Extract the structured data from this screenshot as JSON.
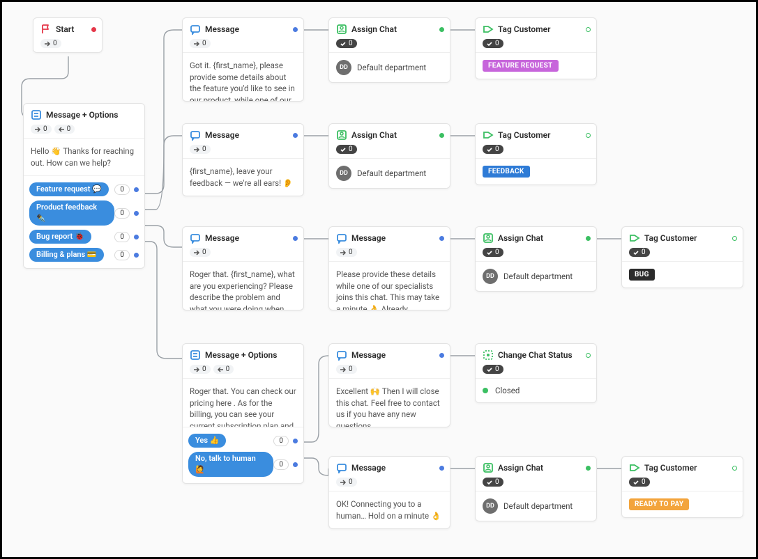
{
  "start": {
    "title": "Start",
    "count": 0
  },
  "mo1": {
    "title": "Message + Options",
    "count_out": 0,
    "count_in": 0,
    "body": "Hello 👋 Thanks for reaching out. How can we help?",
    "options": [
      {
        "label": "Feature request 💬",
        "count": 0
      },
      {
        "label": "Product feedback ✒️",
        "count": 0
      },
      {
        "label": "Bug report 🐞",
        "count": 0
      },
      {
        "label": "Billing & plans 💳",
        "count": 0
      }
    ]
  },
  "msg1": {
    "title": "Message",
    "count": 0,
    "body": "Got it. {first_name}, please provide some details about the feature you'd like to see in our product, while one of our experts joins this chat."
  },
  "msg2": {
    "title": "Message",
    "count": 0,
    "body": "{first_name}, leave your feedback — we're all ears! 👂"
  },
  "msg3": {
    "title": "Message",
    "count": 0,
    "body": "Roger that. {first_name}, what are you experiencing? Please describe the problem and what you were doing when you encountered it. If"
  },
  "msg3b": {
    "title": "Message",
    "count": 0,
    "body": "Please provide these details while one of our specialists joins this chat. This may take a minute 👌 Already"
  },
  "mo2": {
    "title": "Message + Options",
    "count_out": 0,
    "count_in": 0,
    "body": "Roger that. You can check our pricing here . As for the billing, you can see your current subscription plan and manage your billing",
    "options": [
      {
        "label": "Yes 👍",
        "count": 0
      },
      {
        "label": "No, talk to human 🙋",
        "count": 0
      }
    ]
  },
  "msg4": {
    "title": "Message",
    "count": 0,
    "body": "Excellent 🙌 Then I will close this chat. Feel free to contact us if you have any new questions."
  },
  "msg5": {
    "title": "Message",
    "count": 0,
    "body": "OK! Connecting you to a human… Hold on a minute 👌"
  },
  "assign1": {
    "title": "Assign Chat",
    "count": 0,
    "dept": "Default department",
    "dept_initials": "DD"
  },
  "assign2": {
    "title": "Assign Chat",
    "count": 0,
    "dept": "Default department",
    "dept_initials": "DD"
  },
  "assign3": {
    "title": "Assign Chat",
    "count": 0,
    "dept": "Default department",
    "dept_initials": "DD"
  },
  "assign4": {
    "title": "Assign Chat",
    "count": 0,
    "dept": "Default department",
    "dept_initials": "DD"
  },
  "tag1": {
    "title": "Tag Customer",
    "count": 0,
    "tag": "FEATURE REQUEST"
  },
  "tag2": {
    "title": "Tag Customer",
    "count": 0,
    "tag": "FEEDBACK"
  },
  "tag3": {
    "title": "Tag Customer",
    "count": 0,
    "tag": "BUG"
  },
  "tag4": {
    "title": "Tag Customer",
    "count": 0,
    "tag": "READY TO PAY"
  },
  "status1": {
    "title": "Change Chat Status",
    "count": 0,
    "status": "Closed"
  }
}
